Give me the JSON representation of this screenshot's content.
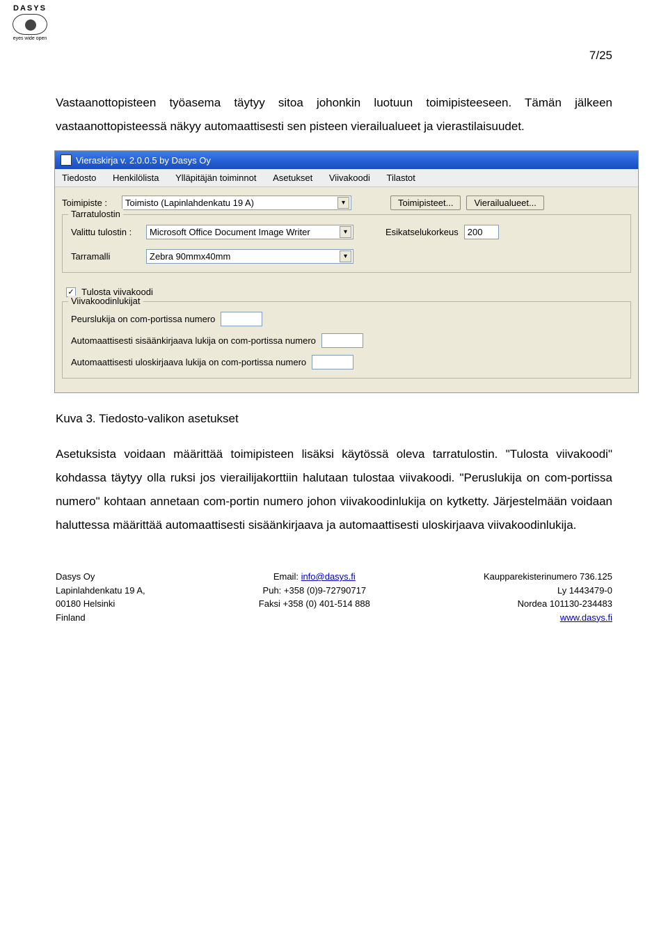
{
  "logo": {
    "brand": "DASYS",
    "tagline": "eyes wide open"
  },
  "pagenum": "7/25",
  "para1": "Vastaanottopisteen työasema täytyy sitoa johonkin luotuun toimipisteeseen. Tämän jälkeen vastaanottopisteessä näkyy automaattisesti sen pisteen vierailualueet ja vierastilaisuudet.",
  "caption": "Kuva 3. Tiedosto-valikon asetukset",
  "para2": "Asetuksista voidaan määrittää toimipisteen lisäksi käytössä oleva tarratulostin. \"Tulosta viivakoodi\" kohdassa täytyy olla ruksi jos vierailijakorttiin halutaan tulostaa viivakoodi. \"Peruslukija on com-portissa numero\" kohtaan annetaan com-portin numero johon viivakoodinlukija on kytketty. Järjestelmään voidaan haluttessa määrittää automaattisesti sisäänkirjaava ja automaattisesti uloskirjaava viivakoodinlukija.",
  "app": {
    "title": "Vieraskirja v. 2.0.0.5 by Dasys Oy",
    "menus": [
      "Tiedosto",
      "Henkilölista",
      "Ylläpitäjän toiminnot",
      "Asetukset",
      "Viivakoodi",
      "Tilastot"
    ],
    "toimipiste_label": "Toimipiste :",
    "toimipiste_value": "Toimisto (Lapinlahdenkatu 19 A)",
    "btn_toimipisteet": "Toimipisteet...",
    "btn_vierailualueet": "Vierailualueet...",
    "group_tarratulostin": "Tarratulostin",
    "valittu_tulostin_label": "Valittu tulostin :",
    "valittu_tulostin_value": "Microsoft Office Document Image Writer",
    "esikatselukorkeus_label": "Esikatselukorkeus",
    "esikatselukorkeus_value": "200",
    "tarramalli_label": "Tarramalli",
    "tarramalli_value": "Zebra 90mmx40mm",
    "tulosta_viivakoodi": "Tulosta viivakoodi",
    "group_viivakoodinlukijat": "Viivakoodinlukijat",
    "peruslukija": "Peurslukija on com-portissa numero",
    "auto_sisaan": "Automaattisesti sisäänkirjaava lukija on com-portissa numero",
    "auto_ulos": "Automaattisesti uloskirjaava lukija on com-portissa numero"
  },
  "footer": {
    "left": [
      "Dasys Oy",
      "Lapinlahdenkatu 19 A,",
      "00180 Helsinki",
      "Finland"
    ],
    "center": [
      "",
      "Email: info@dasys.fi",
      "Puh: +358 (0)9-72790717",
      "Faksi +358 (0) 401-514 888"
    ],
    "right": [
      "Kaupparekisterinumero 736.125",
      "Ly 1443479-0",
      "Nordea 101130-234483",
      "www.dasys.fi"
    ]
  }
}
